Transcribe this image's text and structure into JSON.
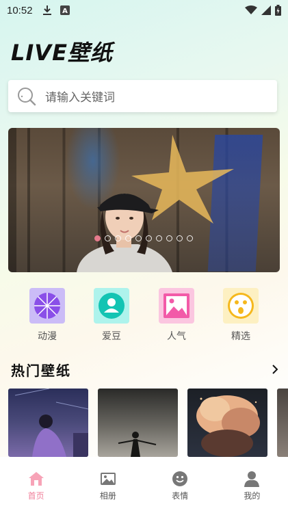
{
  "status_bar": {
    "time": "10:52",
    "left_icons": [
      "download-icon",
      "a-notification-icon"
    ],
    "right_icons": [
      "wifi-icon",
      "signal-icon",
      "battery-icon"
    ]
  },
  "header": {
    "title": "LIVE壁纸"
  },
  "search": {
    "placeholder": "请输入关键词"
  },
  "banner": {
    "dot_count": 10,
    "active_index": 0,
    "active_color": "#e67b8d"
  },
  "categories": [
    {
      "label": "动漫",
      "icon": "umbrella-icon",
      "bg": "#cbbcf7",
      "fg": "#8a4fe8"
    },
    {
      "label": "爱豆",
      "icon": "person-badge-icon",
      "bg": "#aef3ec",
      "fg": "#13c4b3"
    },
    {
      "label": "人气",
      "icon": "image-icon",
      "bg": "#fbc6e0",
      "fg": "#f25aa8"
    },
    {
      "label": "精选",
      "icon": "surprised-face-icon",
      "bg": "#fdf0c2",
      "fg": "#f5b81d"
    }
  ],
  "hot_section": {
    "title": "热门壁纸",
    "more_icon": "chevron-right-icon"
  },
  "bottom_nav": [
    {
      "label": "首页",
      "icon": "home-icon",
      "active": true
    },
    {
      "label": "相册",
      "icon": "photo-album-icon",
      "active": false
    },
    {
      "label": "表情",
      "icon": "smiley-icon",
      "active": false
    },
    {
      "label": "我的",
      "icon": "user-icon",
      "active": false
    }
  ],
  "colors": {
    "accent": "#f07f9a",
    "nav_inactive": "#666666"
  }
}
